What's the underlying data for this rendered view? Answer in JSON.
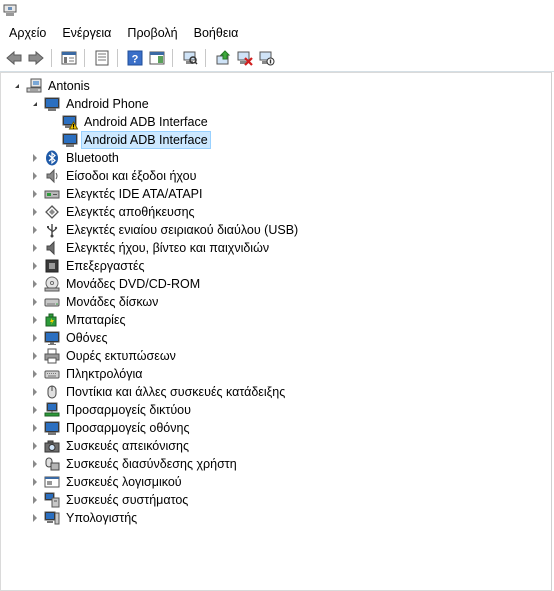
{
  "menu": [
    "Αρχείο",
    "Ενέργεια",
    "Προβολή",
    "Βοήθεια"
  ],
  "toolbar": [
    "back-icon",
    "forward-icon",
    "show-hide-tree-icon",
    "properties-icon",
    "help-icon",
    "action-pane-icon",
    "scan-hardware-icon",
    "update-driver-icon",
    "uninstall-icon",
    "disable-device-icon"
  ],
  "tree": {
    "root": "Antonis",
    "android_phone": "Android Phone",
    "adb_1": "Android ADB Interface",
    "adb_2": "Android ADB Interface",
    "categories": [
      "Bluetooth",
      "Είσοδοι και έξοδοι ήχου",
      "Ελεγκτές IDE ATA/ATAPI",
      "Ελεγκτές αποθήκευσης",
      "Ελεγκτές ενιαίου σειριακού διαύλου (USB)",
      "Ελεγκτές ήχου, βίντεο και παιχνιδιών",
      "Επεξεργαστές",
      "Μονάδες DVD/CD-ROM",
      "Μονάδες δίσκων",
      "Μπαταρίες",
      "Οθόνες",
      "Ουρές εκτυπώσεων",
      "Πληκτρολόγια",
      "Ποντίκια και άλλες συσκευές κατάδειξης",
      "Προσαρμογείς δικτύου",
      "Προσαρμογείς οθόνης",
      "Συσκευές απεικόνισης",
      "Συσκευές διασύνδεσης χρήστη",
      "Συσκευές λογισμικού",
      "Συσκευές συστήματος",
      "Υπολογιστής"
    ]
  }
}
